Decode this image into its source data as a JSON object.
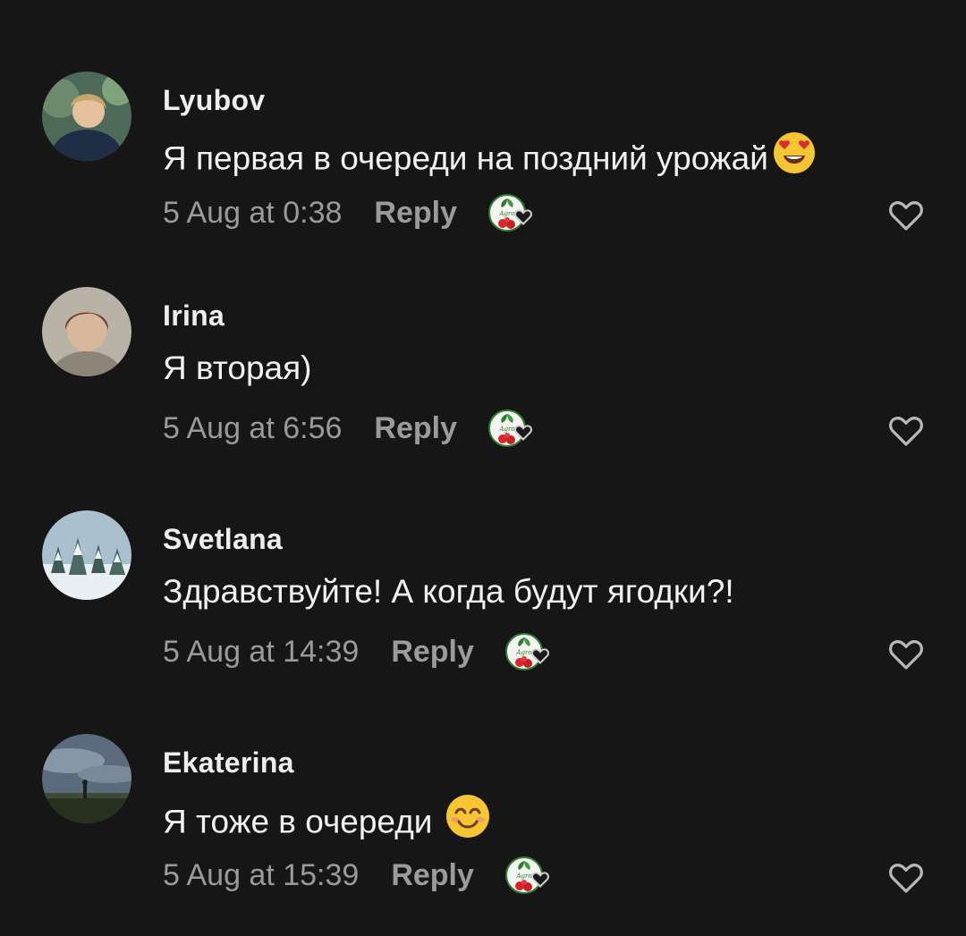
{
  "colors": {
    "background": "#161616",
    "text": "#f2f2f2",
    "meta": "#9a9a9a",
    "heart_outline": "#b8b8b8",
    "author_badge_berry": "#d8262c",
    "author_badge_leaf": "#2f7d32"
  },
  "comments": [
    {
      "author": "Lyubov",
      "text": "Я первая в очереди на поздний урожай",
      "emoji": "smiling-face-with-heart-eyes",
      "date": "5 Aug at 0:38",
      "reply_label": "Reply",
      "liked_by_author_icon": "author-heart-badge-icon",
      "like_icon": "heart-outline-icon"
    },
    {
      "author": "Irina",
      "text": "Я вторая)",
      "date": "5 Aug at 6:56",
      "reply_label": "Reply",
      "liked_by_author_icon": "author-heart-badge-icon",
      "like_icon": "heart-outline-icon"
    },
    {
      "author": "Svetlana",
      "text": "Здравствуйте! А когда будут ягодки?!",
      "date": "5 Aug at 14:39",
      "reply_label": "Reply",
      "liked_by_author_icon": "author-heart-badge-icon",
      "like_icon": "heart-outline-icon"
    },
    {
      "author": "Ekaterina",
      "text": "Я тоже в очереди",
      "emoji": "smiling-face-with-smiling-eyes",
      "date": "5 Aug at 15:39",
      "reply_label": "Reply",
      "liked_by_author_icon": "author-heart-badge-icon",
      "like_icon": "heart-outline-icon"
    }
  ]
}
